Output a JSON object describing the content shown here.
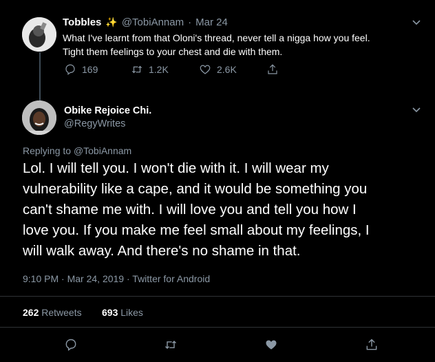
{
  "parent_tweet": {
    "name": "Tobbles",
    "name_emoji": "✨",
    "handle": "@TobiAnnam",
    "separator": "·",
    "date": "Mar 24",
    "text_line1": "What I've learnt from that Oloni's thread, never tell a nigga how you feel.",
    "text_line2": "Tight them feelings to your chest and die with them.",
    "replies": "169",
    "retweets": "1.2K",
    "likes": "2.6K"
  },
  "main_tweet": {
    "name": "Obike Rejoice Chi.",
    "handle": "@RegyWrites",
    "replying_prefix": "Replying to",
    "replying_to": "@TobiAnnam",
    "text_lines": [
      "Lol. I will tell you. I won't die with it. I will wear my",
      "vulnerability like a cape, and it would be something you",
      "can't shame me with. I will love you and tell you how I",
      "love you.  If you make me feel small about my feelings, I",
      "will walk away. And there's no shame in that."
    ],
    "time": "9:10 PM",
    "dot": "·",
    "date": "Mar 24, 2019",
    "source": "Twitter for Android",
    "retweets_count": "262",
    "retweets_label": "Retweets",
    "likes_count": "693",
    "likes_label": "Likes"
  },
  "colors": {
    "background": "#000000",
    "muted_text": "#8b98a5",
    "primary_text": "#ffffff",
    "divider": "#2f3336"
  },
  "icons": [
    "reply-icon",
    "retweet-icon",
    "like-icon",
    "share-icon",
    "chevron-down-icon",
    "sparkles-icon"
  ]
}
